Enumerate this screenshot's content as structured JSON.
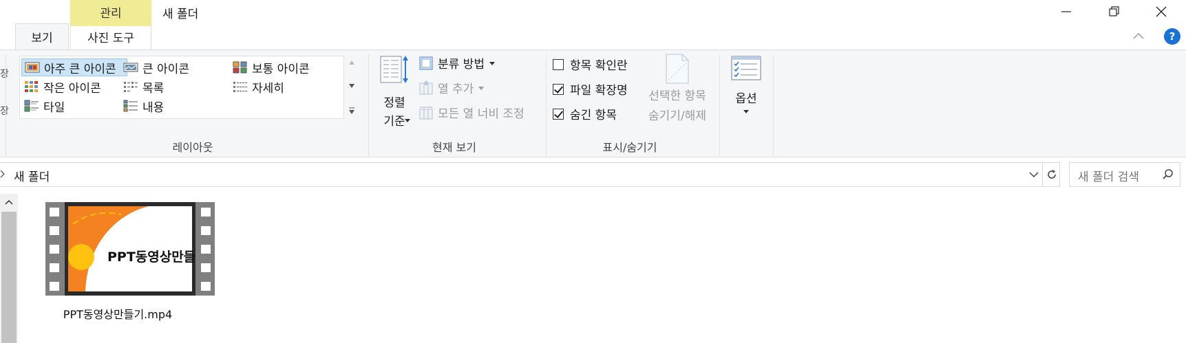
{
  "titlebar": {
    "context_tab": "관리",
    "title": "새 폴더",
    "minimize_icon": "minimize-icon",
    "restore_icon": "restore-icon",
    "close_icon": "close-icon"
  },
  "tabs": {
    "view": "보기",
    "photo_tools": "사진 도구"
  },
  "ribbon": {
    "edge_fragments": [
      "장",
      "장"
    ],
    "layout": {
      "label": "레이아웃",
      "items": [
        {
          "label": "아주 큰 아이콘",
          "icon": "extra-large-icons-icon",
          "selected": true
        },
        {
          "label": "큰 아이콘",
          "icon": "large-icons-icon"
        },
        {
          "label": "보통 아이콘",
          "icon": "medium-icons-icon"
        },
        {
          "label": "작은 아이콘",
          "icon": "small-icons-icon"
        },
        {
          "label": "목록",
          "icon": "list-icon"
        },
        {
          "label": "자세히",
          "icon": "details-icon"
        },
        {
          "label": "타일",
          "icon": "tiles-icon"
        },
        {
          "label": "내용",
          "icon": "content-icon"
        }
      ]
    },
    "current_view": {
      "label": "현재 보기",
      "sort_by_line1": "정렬",
      "sort_by_line2": "기준",
      "group_by": "분류 방법",
      "add_columns": "열 추가",
      "size_columns": "모든 열 너비 조정"
    },
    "show_hide": {
      "label": "표시/숨기기",
      "item_checkboxes": {
        "label": "항목 확인란",
        "checked": false
      },
      "file_extensions": {
        "label": "파일 확장명",
        "checked": true
      },
      "hidden_items": {
        "label": "숨긴 항목",
        "checked": true
      },
      "hide_selected_line1": "선택한 항목",
      "hide_selected_line2": "숨기기/해제"
    },
    "options": {
      "label": "옵션"
    }
  },
  "addressbar": {
    "path": "새 폴더"
  },
  "search": {
    "placeholder": "새 폴더 검색"
  },
  "files": [
    {
      "name": "PPT동영상만들기.mp4",
      "thumbnail_text": "PPT동영상만들",
      "colors": {
        "orange": "#f58220",
        "yellow": "#ffc20e",
        "film": "#808080"
      }
    }
  ],
  "colors": {
    "context_tab": "#f0ec96",
    "selection": "#cce4f7",
    "help": "#1a73d4"
  }
}
